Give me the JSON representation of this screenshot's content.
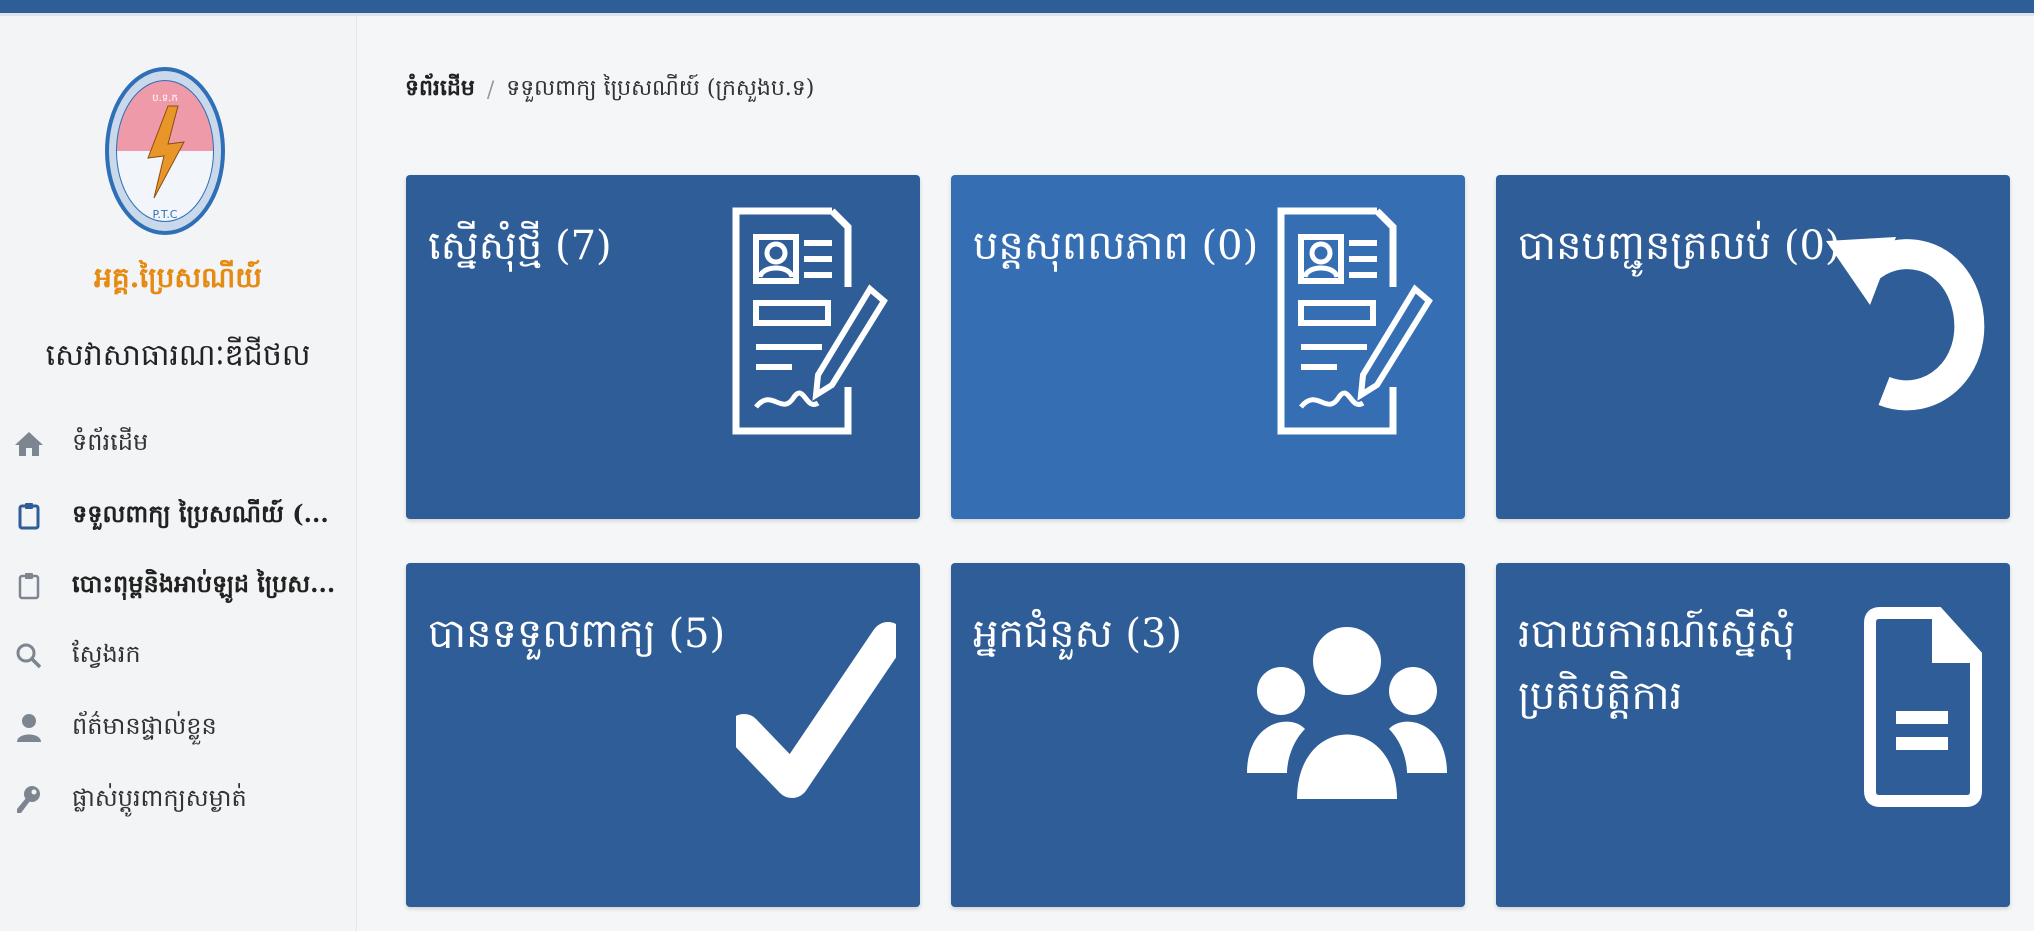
{
  "sidebar": {
    "org_name": "អគ្គ.ប្រៃសណីយ៍",
    "org_subtitle": "សេវាសាធារណៈឌីជីថល",
    "items": [
      {
        "label": "ទំព័រដើម",
        "icon": "home-icon"
      },
      {
        "label": "ទទួលពាក្យ ប្រៃសណីយ៍ (...",
        "icon": "clipboard-icon"
      },
      {
        "label": "បោះពុម្ពនិងអាប់ឡូដ ប្រៃស...",
        "icon": "clipboard-icon"
      },
      {
        "label": "ស្វែងរក",
        "icon": "search-icon"
      },
      {
        "label": "ព័ត៌មានផ្ទាល់ខ្លួន",
        "icon": "user-icon"
      },
      {
        "label": "ផ្លាស់ប្តូរពាក្យសម្ងាត់",
        "icon": "key-icon"
      }
    ]
  },
  "breadcrumb": {
    "home": "ទំព័រដើម",
    "separator": "/",
    "current": "ទទួលពាក្យ ប្រៃសណីយ៍ (ក្រសួងប.ទ)"
  },
  "tiles": [
    {
      "label": "ស្នើសុំថ្មី (7)",
      "icon": "document-sign-icon"
    },
    {
      "label": "បន្តសុពលភាព (0)",
      "icon": "document-sign-icon"
    },
    {
      "label": "បានបញ្ជូនត្រលប់ (0)",
      "icon": "undo-icon"
    },
    {
      "label": "បានទទួលពាក្យ (5)",
      "icon": "checkmark-icon"
    },
    {
      "label": "អ្នកជំនួស (3)",
      "icon": "users-icon"
    },
    {
      "label": "របាយការណ៍ស្នើសុំប្រតិបត្តិការ",
      "icon": "file-icon"
    }
  ],
  "colors": {
    "tile": "#2f5d97",
    "tile_highlight": "#366eb4",
    "brand_orange": "#e58a13"
  }
}
